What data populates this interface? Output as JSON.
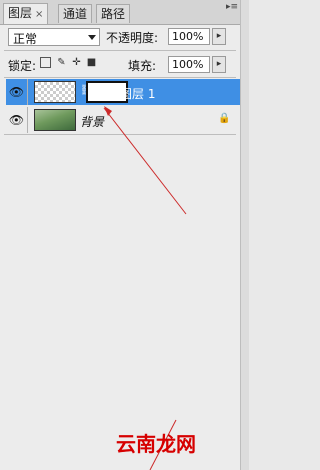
{
  "tabs": [
    {
      "label": "图层",
      "close": "×"
    },
    {
      "label": "通道"
    },
    {
      "label": "路径"
    }
  ],
  "corner_mark": "▸≡",
  "blend_mode": {
    "value": "正常"
  },
  "opacity": {
    "label": "不透明度:",
    "value": "100%"
  },
  "lock": {
    "label": "锁定:"
  },
  "fill": {
    "label": "填充:",
    "value": "100%"
  },
  "layers": [
    {
      "name": "图层 1",
      "selected": true
    },
    {
      "name": "背景",
      "locked": true
    }
  ],
  "watermark": "云南龙网",
  "annotation_color": "#cc2a2a"
}
